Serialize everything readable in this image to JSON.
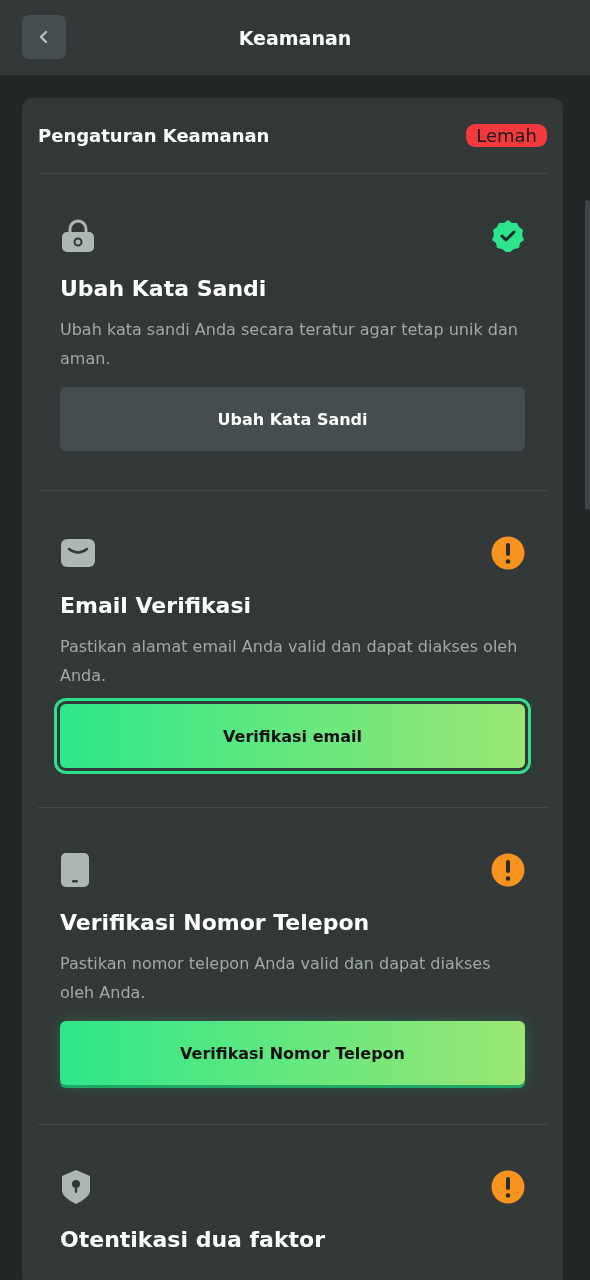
{
  "header": {
    "title": "Keamanan"
  },
  "card": {
    "title": "Pengaturan Keamanan",
    "badge": "Lemah",
    "sections": [
      {
        "verified": true,
        "title": "Ubah Kata Sandi",
        "description": "Ubah kata sandi Anda secara teratur agar tetap unik dan aman.",
        "button": {
          "label": "Ubah Kata Sandi",
          "kind": "secondary",
          "focused": false
        }
      },
      {
        "verified": false,
        "title": "Email Verifikasi",
        "description": "Pastikan alamat email Anda valid dan dapat diakses oleh Anda.",
        "button": {
          "label": "Verifikasi email",
          "kind": "primary",
          "focused": true
        }
      },
      {
        "verified": false,
        "title": "Verifikasi Nomor Telepon",
        "description": "Pastikan nomor telepon Anda valid dan dapat diakses oleh Anda.",
        "button": {
          "label": "Verifikasi Nomor Telepon",
          "kind": "primary",
          "focused": false
        }
      },
      {
        "verified": false,
        "title": "Otentikasi dua faktor"
      }
    ]
  }
}
